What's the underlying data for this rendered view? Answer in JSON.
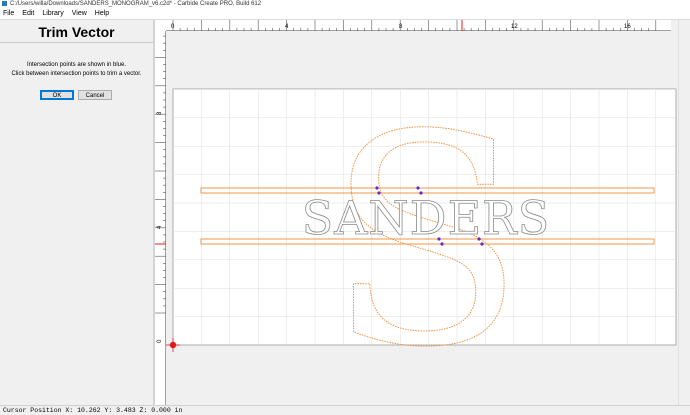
{
  "window": {
    "title": "C:/Users/willa/Downloads/SANDERS_MONOGRAM_v6.c2d* - Carbide Create PRO, Build 612"
  },
  "menu": [
    {
      "label": "File"
    },
    {
      "label": "Edit"
    },
    {
      "label": "Library"
    },
    {
      "label": "View"
    },
    {
      "label": "Help"
    }
  ],
  "panel": {
    "title": "Trim Vector",
    "instructions": [
      "Intersection points are shown in blue.",
      "Click between intersection points to trim a vector."
    ],
    "ok_label": "OK",
    "cancel_label": "Cancel"
  },
  "rulers": {
    "top_ticks": [
      "0",
      "4",
      "8",
      "12",
      "16"
    ],
    "left_ticks": [
      "8",
      "4",
      "0"
    ]
  },
  "design": {
    "monogram_letter": "S",
    "name_text": "SANDERS",
    "accent_color": "#f28c38",
    "intersection_color": "#5a2fc7",
    "cursor_marker_color": "#e01b1b"
  },
  "status": {
    "cursor_position": "Cursor Position X: 10.262 Y: 3.483 Z: 0.000 in"
  }
}
